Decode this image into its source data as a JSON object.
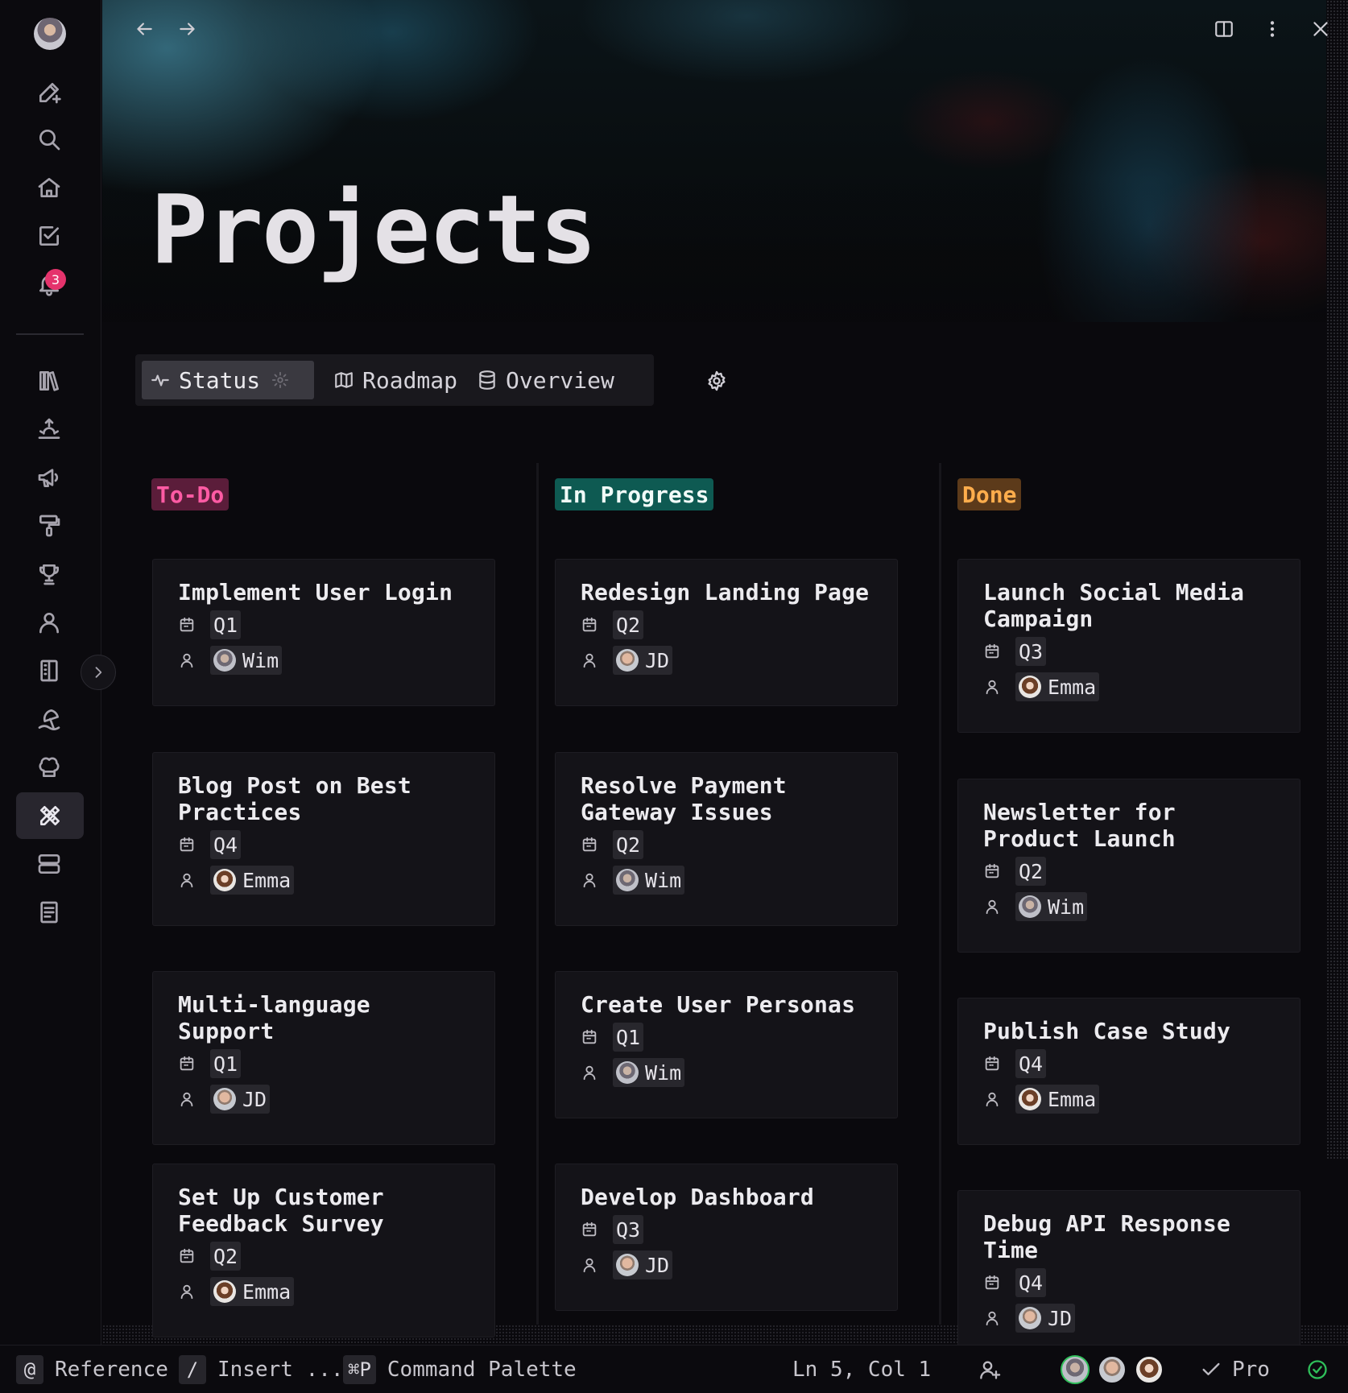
{
  "page": {
    "title": "Projects"
  },
  "rail": {
    "notification_count": "3"
  },
  "tabs": [
    {
      "label": "Status",
      "icon": "activity-icon",
      "active": true
    },
    {
      "label": "Roadmap",
      "icon": "map-icon",
      "active": false
    },
    {
      "label": "Overview",
      "icon": "database-icon",
      "active": false
    }
  ],
  "columns": [
    {
      "label": "To-Do",
      "cards": [
        {
          "title": "Implement User Login",
          "quarter": "Q1",
          "assignee": "Wim"
        },
        {
          "title": "Blog Post on Best Practices",
          "quarter": "Q4",
          "assignee": "Emma"
        },
        {
          "title": "Multi-language Support",
          "quarter": "Q1",
          "assignee": "JD"
        },
        {
          "title": "Set Up Customer Feedback Survey",
          "quarter": "Q2",
          "assignee": "Emma"
        }
      ]
    },
    {
      "label": "In Progress",
      "cards": [
        {
          "title": "Redesign Landing Page",
          "quarter": "Q2",
          "assignee": "JD"
        },
        {
          "title": "Resolve Payment Gateway Issues",
          "quarter": "Q2",
          "assignee": "Wim"
        },
        {
          "title": "Create User Personas",
          "quarter": "Q1",
          "assignee": "Wim"
        },
        {
          "title": "Develop Dashboard",
          "quarter": "Q3",
          "assignee": "JD"
        }
      ]
    },
    {
      "label": "Done",
      "cards": [
        {
          "title": "Launch Social Media Campaign",
          "quarter": "Q3",
          "assignee": "Emma"
        },
        {
          "title": "Newsletter for Product Launch",
          "quarter": "Q2",
          "assignee": "Wim"
        },
        {
          "title": "Publish Case Study",
          "quarter": "Q4",
          "assignee": "Emma"
        },
        {
          "title": "Debug API Response Time",
          "quarter": "Q4",
          "assignee": "JD"
        }
      ]
    }
  ],
  "statusbar": {
    "reference_key": "@",
    "reference_label": "Reference",
    "insert_key": "/",
    "insert_label": "Insert ...",
    "palette_key": "⌘P",
    "palette_label": "Command Palette",
    "cursor_position": "Ln 5, Col 1",
    "plan_label": "Pro"
  },
  "colors": {
    "todo_label": "#ff5ba4",
    "in_progress_bg": "#0e5a52",
    "done_label": "#ffad4c",
    "notification": "#e5336c",
    "sync_ok": "#2fbf5a"
  }
}
